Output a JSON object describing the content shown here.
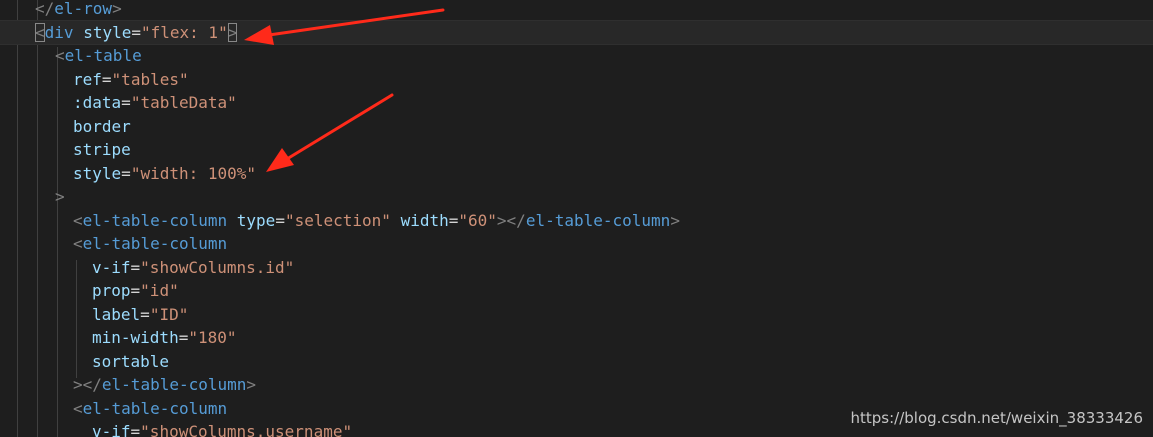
{
  "editor": {
    "colors": {
      "background": "#1e1e1e",
      "tag": "#569cd6",
      "attribute": "#9cdcfe",
      "string": "#ce9178",
      "punctuation": "#808080",
      "text": "#d4d4d4",
      "arrow": "#ff2a1a"
    },
    "lines": [
      {
        "tokens": [
          [
            "punct",
            "</"
          ],
          [
            "tag",
            "el-row"
          ],
          [
            "punct",
            ">"
          ]
        ]
      },
      {
        "active": true,
        "tokens": [
          [
            "punct_box",
            "<"
          ],
          [
            "tag",
            "div"
          ],
          [
            "text",
            " "
          ],
          [
            "attr",
            "style"
          ],
          [
            "eq",
            "="
          ],
          [
            "str",
            "\"flex: 1\""
          ],
          [
            "punct_box",
            ">"
          ]
        ]
      },
      {
        "tokens": [
          [
            "punct",
            "<"
          ],
          [
            "tag",
            "el-table"
          ]
        ]
      },
      {
        "tokens": [
          [
            "attr",
            "ref"
          ],
          [
            "eq",
            "="
          ],
          [
            "str",
            "\"tables\""
          ]
        ]
      },
      {
        "tokens": [
          [
            "attr",
            ":data"
          ],
          [
            "eq",
            "="
          ],
          [
            "str",
            "\"tableData\""
          ]
        ]
      },
      {
        "tokens": [
          [
            "attr",
            "border"
          ]
        ]
      },
      {
        "tokens": [
          [
            "attr",
            "stripe"
          ]
        ]
      },
      {
        "tokens": [
          [
            "attr",
            "style"
          ],
          [
            "eq",
            "="
          ],
          [
            "str",
            "\"width: 100%\""
          ]
        ]
      },
      {
        "tokens": [
          [
            "punct",
            ">"
          ]
        ]
      },
      {
        "tokens": [
          [
            "punct",
            "<"
          ],
          [
            "tag",
            "el-table-column"
          ],
          [
            "text",
            " "
          ],
          [
            "attr",
            "type"
          ],
          [
            "eq",
            "="
          ],
          [
            "str",
            "\"selection\""
          ],
          [
            "text",
            " "
          ],
          [
            "attr",
            "width"
          ],
          [
            "eq",
            "="
          ],
          [
            "str",
            "\"60\""
          ],
          [
            "punct",
            "></"
          ],
          [
            "tag",
            "el-table-column"
          ],
          [
            "punct",
            ">"
          ]
        ]
      },
      {
        "tokens": [
          [
            "punct",
            "<"
          ],
          [
            "tag",
            "el-table-column"
          ]
        ]
      },
      {
        "tokens": [
          [
            "attr",
            "v-if"
          ],
          [
            "eq",
            "="
          ],
          [
            "str",
            "\"showColumns.id\""
          ]
        ]
      },
      {
        "tokens": [
          [
            "attr",
            "prop"
          ],
          [
            "eq",
            "="
          ],
          [
            "str",
            "\"id\""
          ]
        ]
      },
      {
        "tokens": [
          [
            "attr",
            "label"
          ],
          [
            "eq",
            "="
          ],
          [
            "str",
            "\"ID\""
          ]
        ]
      },
      {
        "tokens": [
          [
            "attr",
            "min-width"
          ],
          [
            "eq",
            "="
          ],
          [
            "str",
            "\"180\""
          ]
        ]
      },
      {
        "tokens": [
          [
            "attr",
            "sortable"
          ]
        ]
      },
      {
        "tokens": [
          [
            "punct",
            "></"
          ],
          [
            "tag",
            "el-table-column"
          ],
          [
            "punct",
            ">"
          ]
        ]
      },
      {
        "tokens": [
          [
            "punct",
            "<"
          ],
          [
            "tag",
            "el-table-column"
          ]
        ]
      },
      {
        "tokens": [
          [
            "attr",
            "v-if"
          ],
          [
            "eq",
            "="
          ],
          [
            "str",
            "\"showColumns.username\""
          ]
        ]
      }
    ]
  },
  "watermark": "https://blog.csdn.net/weixin_38333426"
}
